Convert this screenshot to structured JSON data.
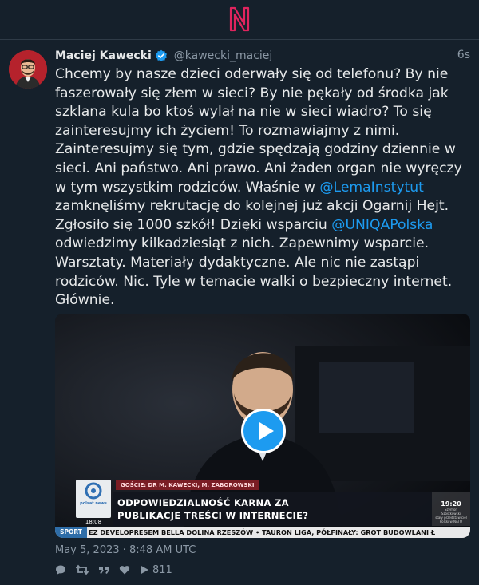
{
  "colors": {
    "background": "#15202b",
    "text": "#e7e9ea",
    "muted": "#8b98a5",
    "link": "#1d9bf0",
    "logo": "#e0245e"
  },
  "header": {
    "logo_icon": "n-logo-icon"
  },
  "tweet": {
    "author_name": "Maciej Kawecki",
    "author_handle": "@kawecki_maciej",
    "verified_icon": "verified-badge-icon",
    "time_ago": "6s",
    "text_parts": [
      "Chcemy by nasze dzieci oderwały się od telefonu? By nie faszerowały się złem w sieci? By nie pękały od środka jak szklana kula bo ktoś wylał na nie w sieci wiadro? To się zainteresujmy ich życiem! To rozmawiajmy z nimi. Zainteresujmy się tym, gdzie spędzają godziny dziennie w sieci. Ani państwo. Ani prawo. Ani żaden organ nie wyręczy w tym wszystkim rodziców. Właśnie w ",
      "@LemaInstytut",
      " zamknęliśmy rekrutację do kolejnej już akcji Ogarnij Hejt. Zgłosiło się 1000 szkół! Dzięki wsparciu ",
      "@UNIQAPolska",
      " odwiedzimy kilkadziesiąt z nich. Zapewnimy wsparcie. Warsztaty. Materiały dydaktyczne. Ale nic nie zastąpi rodziców. Nic. Tyle w temacie walki o bezpieczny internet. Głównie."
    ],
    "date": "May 5, 2023 · 8:48 AM UTC",
    "views": "811"
  },
  "video": {
    "play_icon": "play-icon",
    "guests": "GOŚCIE: DR M. KAWECKI, M. ZABOROWSKI",
    "headline_line1": "ODPOWIEDZIALNOŚĆ KARNA ZA",
    "headline_line2": "PUBLIKACJE TREŚCI W INTERNECIE?",
    "channel_logo": "polsat news",
    "clock_time": "19:20",
    "clock_sub1": "Szymon",
    "clock_sub2": "Szostkowski",
    "clock_sub3": "stały przedstawiciel",
    "clock_sub4": "Polski w NATO",
    "screen_time": "18:08",
    "ticker_tag": "SPORT",
    "ticker_text": "EZ DEVELOPRESEM BELLA DOLINA RZESZÓW  •  TAURON LIGA, PÓŁFINAŁY: GROT BUDOWLANI Ł"
  },
  "actions": [
    {
      "icon": "reply-icon"
    },
    {
      "icon": "retweet-icon"
    },
    {
      "icon": "quote-icon"
    },
    {
      "icon": "like-icon"
    },
    {
      "icon": "views-icon"
    }
  ]
}
